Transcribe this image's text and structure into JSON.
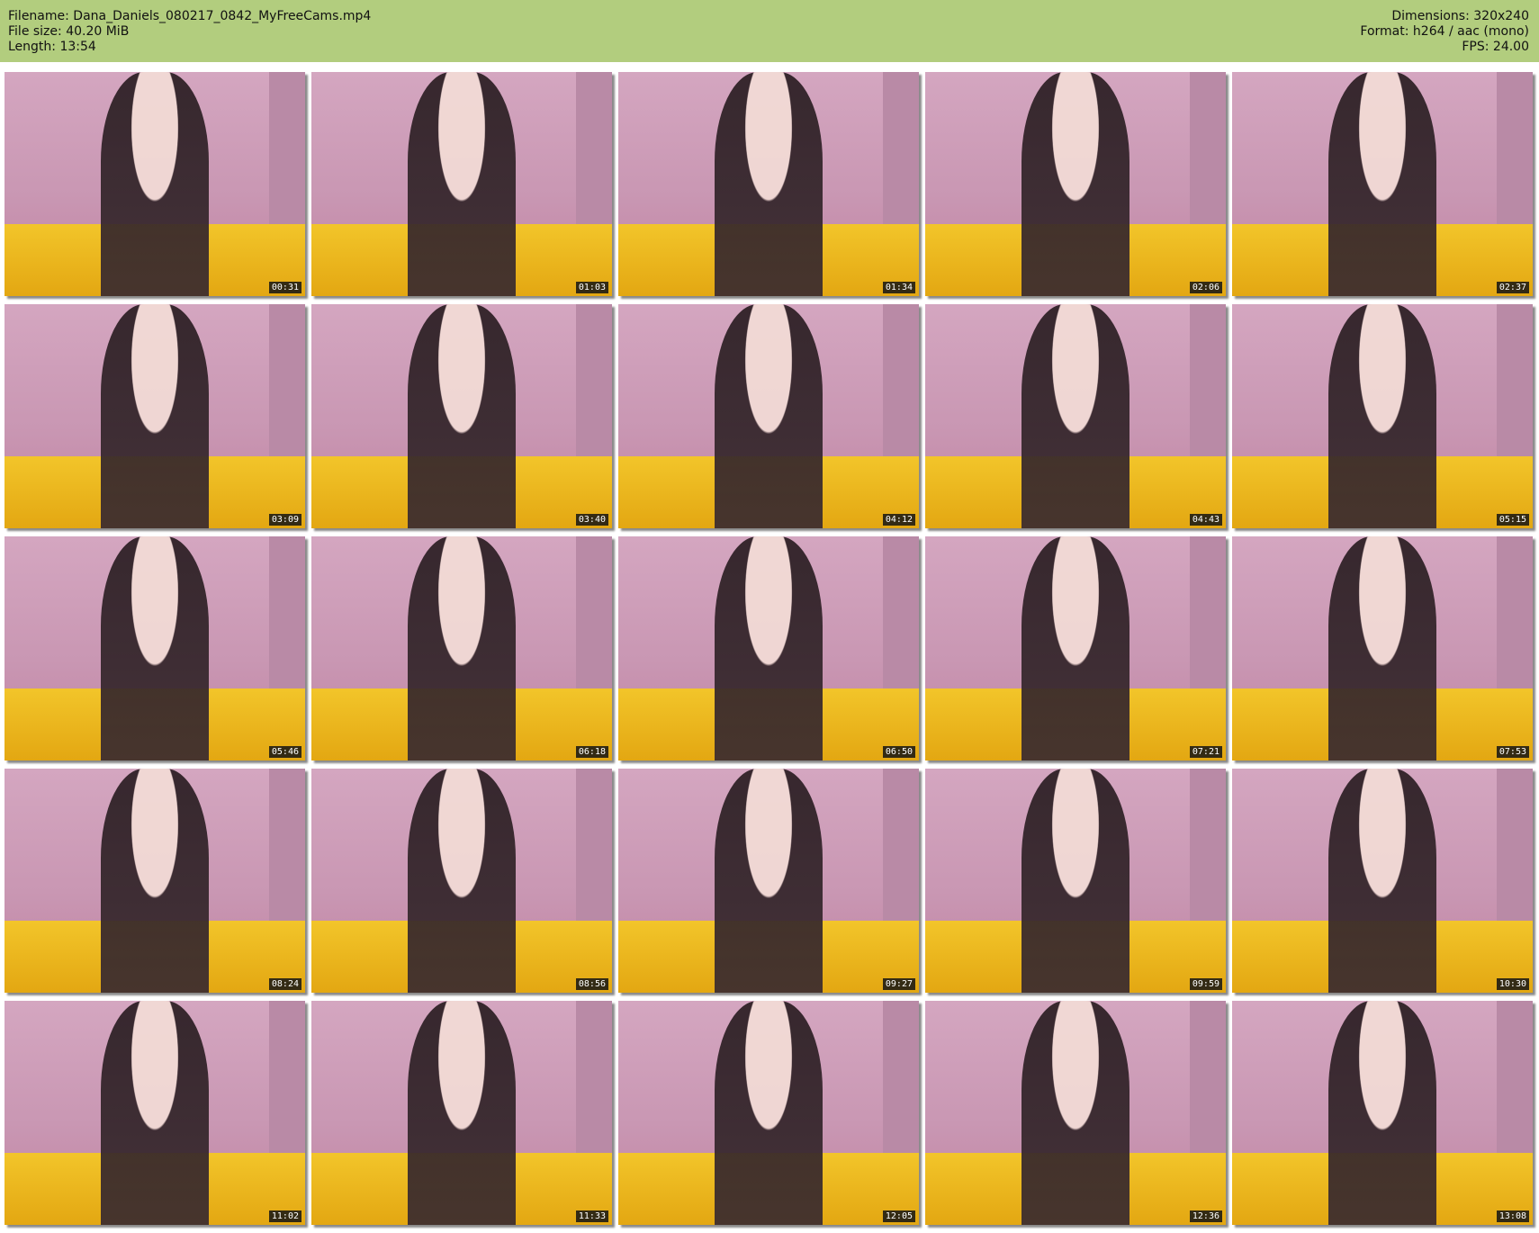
{
  "header": {
    "filename": "Filename: Dana_Daniels_080217_0842_MyFreeCams.mp4",
    "file_size": "File size: 40.20 MiB",
    "length": "Length: 13:54",
    "dimensions": "Dimensions: 320x240",
    "format": "Format: h264 / aac (mono)",
    "fps": "FPS: 24.00"
  },
  "thumbnails": [
    "00:31",
    "01:03",
    "01:34",
    "02:06",
    "02:37",
    "03:09",
    "03:40",
    "04:12",
    "04:43",
    "05:15",
    "05:46",
    "06:18",
    "06:50",
    "07:21",
    "07:53",
    "08:24",
    "08:56",
    "09:27",
    "09:59",
    "10:30",
    "11:02",
    "11:33",
    "12:05",
    "12:36",
    "13:08"
  ]
}
